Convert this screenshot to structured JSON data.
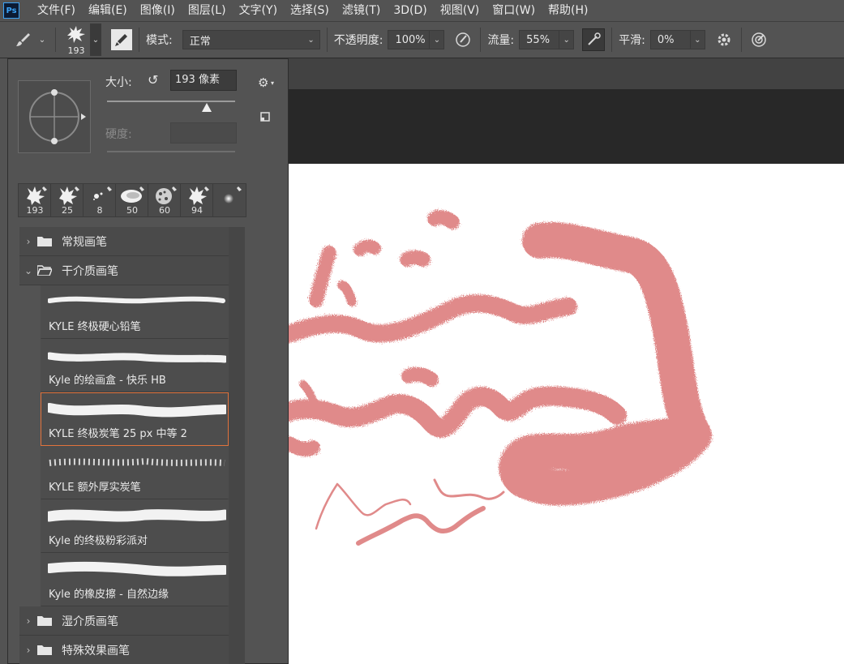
{
  "app": {
    "logo": "Ps"
  },
  "menu": [
    "文件(F)",
    "编辑(E)",
    "图像(I)",
    "图层(L)",
    "文字(Y)",
    "选择(S)",
    "滤镜(T)",
    "3D(D)",
    "视图(V)",
    "窗口(W)",
    "帮助(H)"
  ],
  "options": {
    "brush_size_preview": "193",
    "mode_label": "模式:",
    "mode_value": "正常",
    "opacity_label": "不透明度:",
    "opacity_value": "100%",
    "flow_label": "流量:",
    "flow_value": "55%",
    "smoothing_label": "平滑:",
    "smoothing_value": "0%"
  },
  "brush_panel": {
    "size_label": "大小:",
    "size_value": "193 像素",
    "size_fraction": 0.78,
    "hardness_label": "硬度:",
    "recent_brushes": [
      "193",
      "25",
      "8",
      "50",
      "60",
      "94",
      ""
    ],
    "groups": [
      {
        "name": "常规画笔",
        "expanded": false
      },
      {
        "name": "干介质画笔",
        "expanded": true
      }
    ],
    "brushes": [
      {
        "name": "KYLE 终极硬心铅笔",
        "selected": false
      },
      {
        "name": "Kyle 的绘画盒 - 快乐 HB",
        "selected": false
      },
      {
        "name": "KYLE 终极炭笔 25 px 中等 2",
        "selected": true
      },
      {
        "name": "KYLE 额外厚实炭笔",
        "selected": false
      },
      {
        "name": "Kyle 的终极粉彩派对",
        "selected": false
      },
      {
        "name": "Kyle 的橡皮擦 - 自然边缘",
        "selected": false
      }
    ],
    "groups_after": [
      {
        "name": "湿介质画笔",
        "expanded": false
      },
      {
        "name": "特殊效果画笔",
        "expanded": false
      }
    ]
  },
  "colors": {
    "paint_stroke": "#e08a8a",
    "selection_border": "#e2733c",
    "panel_bg": "#535353"
  }
}
